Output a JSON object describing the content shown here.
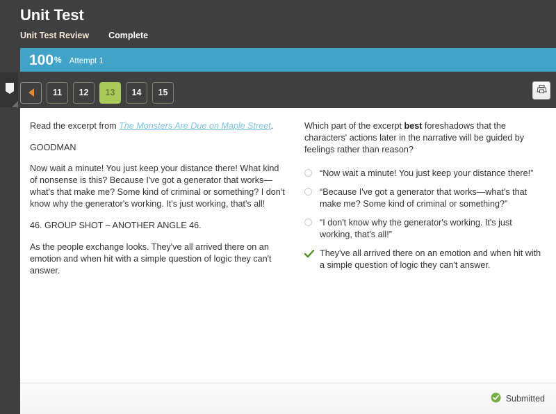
{
  "header": {
    "title": "Unit Test",
    "review_label": "Unit Test Review",
    "status_label": "Complete"
  },
  "score": {
    "value": "100",
    "percent_symbol": "%",
    "attempt_label": "Attempt 1"
  },
  "pager": {
    "prev_label": "",
    "pages": [
      "11",
      "12",
      "13",
      "14",
      "15"
    ],
    "active_page": "13"
  },
  "toolbar": {
    "print_label": "Print"
  },
  "excerpt": {
    "intro_prefix": "Read the excerpt from ",
    "work_title": "The Monsters Are Due on Maple Street",
    "intro_suffix": ".",
    "speaker": "GOODMAN",
    "paragraph_1": "Now wait a minute! You just keep your distance there! What kind of nonsense is this? Because I've got a generator that works—what's that make me? Some kind of criminal or something? I don't know why the generator's working. It's just working, that's all!",
    "scene_heading": "46. GROUP SHOT – ANOTHER ANGLE 46.",
    "paragraph_2": "As the people exchange looks. They've all arrived there on an emotion and when hit with a simple question of logic they can't answer."
  },
  "question": {
    "prefix": "Which part of the excerpt ",
    "emphasis": "best",
    "suffix": " foreshadows that the characters' actions later in the narrative will be guided by feelings rather than reason?",
    "choices": [
      {
        "text": "“Now wait a minute! You just keep your distance there!”",
        "selected": false
      },
      {
        "text": "“Because I've got a generator that works—what's that make me? Some kind of criminal or something?”",
        "selected": false
      },
      {
        "text": "“I don't know why the generator's working. It's just working, that's all!”",
        "selected": false
      },
      {
        "text": "They've all arrived there on an emotion and when hit with a simple question of logic they can't answer.",
        "selected": true
      }
    ]
  },
  "footer": {
    "submitted_label": "Submitted"
  },
  "colors": {
    "header_bg": "#3f3f3f",
    "score_bar": "#41a3c8",
    "active_page": "#a9c95a",
    "prev_arrow": "#e08a33",
    "link": "#7ec2e0",
    "check_green": "#5a9e2f",
    "submitted_green": "#76b043"
  }
}
